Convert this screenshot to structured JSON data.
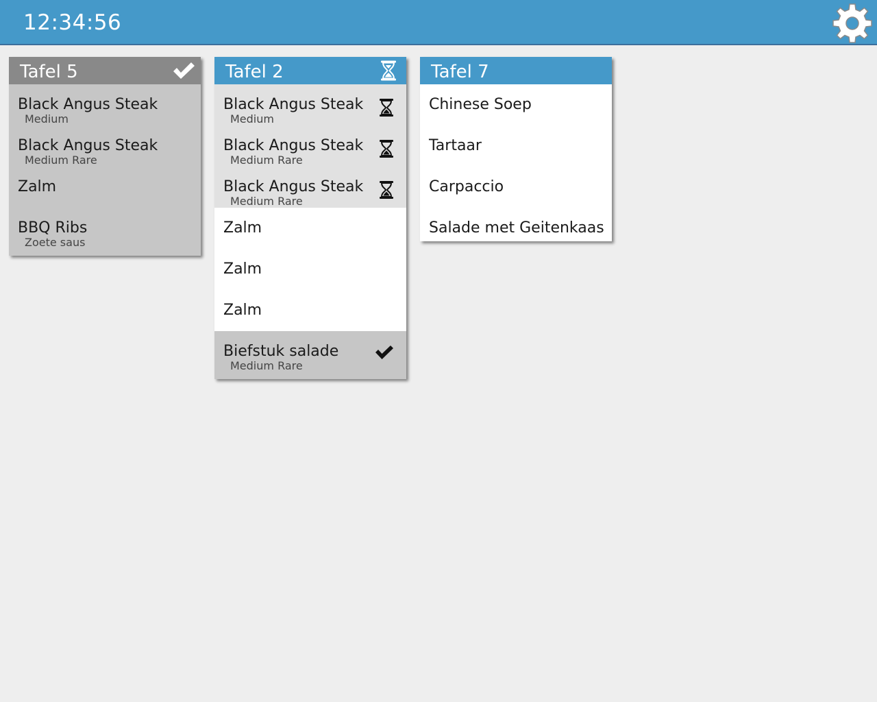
{
  "topbar": {
    "clock": "12:34:56",
    "background_color": "#4599c9",
    "settings_icon": "gear-icon"
  },
  "tickets": [
    {
      "table": "Tafel 5",
      "status": "done",
      "header_icon": "check-icon",
      "header_color": "#898989",
      "orders": [
        {
          "name": "Black Angus Steak",
          "modifier": "Medium"
        },
        {
          "name": "Black Angus Steak",
          "modifier": "Medium Rare"
        },
        {
          "name": "Zalm",
          "modifier": ""
        },
        {
          "name": "BBQ Ribs",
          "modifier": "Zoete saus"
        }
      ]
    },
    {
      "table": "Tafel 2",
      "status": "in-progress",
      "header_icon": "hourglass-icon",
      "header_color": "#4599c9",
      "orders": [
        {
          "name": "Black Angus Steak",
          "modifier": "Medium",
          "state": "waiting",
          "icon": "hourglass-icon"
        },
        {
          "name": "Black Angus Steak",
          "modifier": "Medium Rare",
          "state": "waiting",
          "icon": "hourglass-icon"
        },
        {
          "name": "Black Angus Steak",
          "modifier": "Medium Rare",
          "state": "waiting",
          "icon": "hourglass-icon"
        },
        {
          "name": "Zalm",
          "modifier": "",
          "state": "open"
        },
        {
          "name": "Zalm",
          "modifier": "",
          "state": "open"
        },
        {
          "name": "Zalm",
          "modifier": "",
          "state": "open"
        },
        {
          "name": "Biefstuk salade",
          "modifier": "Medium Rare",
          "state": "done",
          "icon": "check-icon"
        }
      ]
    },
    {
      "table": "Tafel 7",
      "status": "new",
      "header_color": "#4599c9",
      "orders": [
        {
          "name": "Chinese Soep",
          "modifier": ""
        },
        {
          "name": "Tartaar",
          "modifier": ""
        },
        {
          "name": "Carpaccio",
          "modifier": ""
        },
        {
          "name": "Salade met Geitenkaas",
          "modifier": ""
        }
      ]
    }
  ]
}
